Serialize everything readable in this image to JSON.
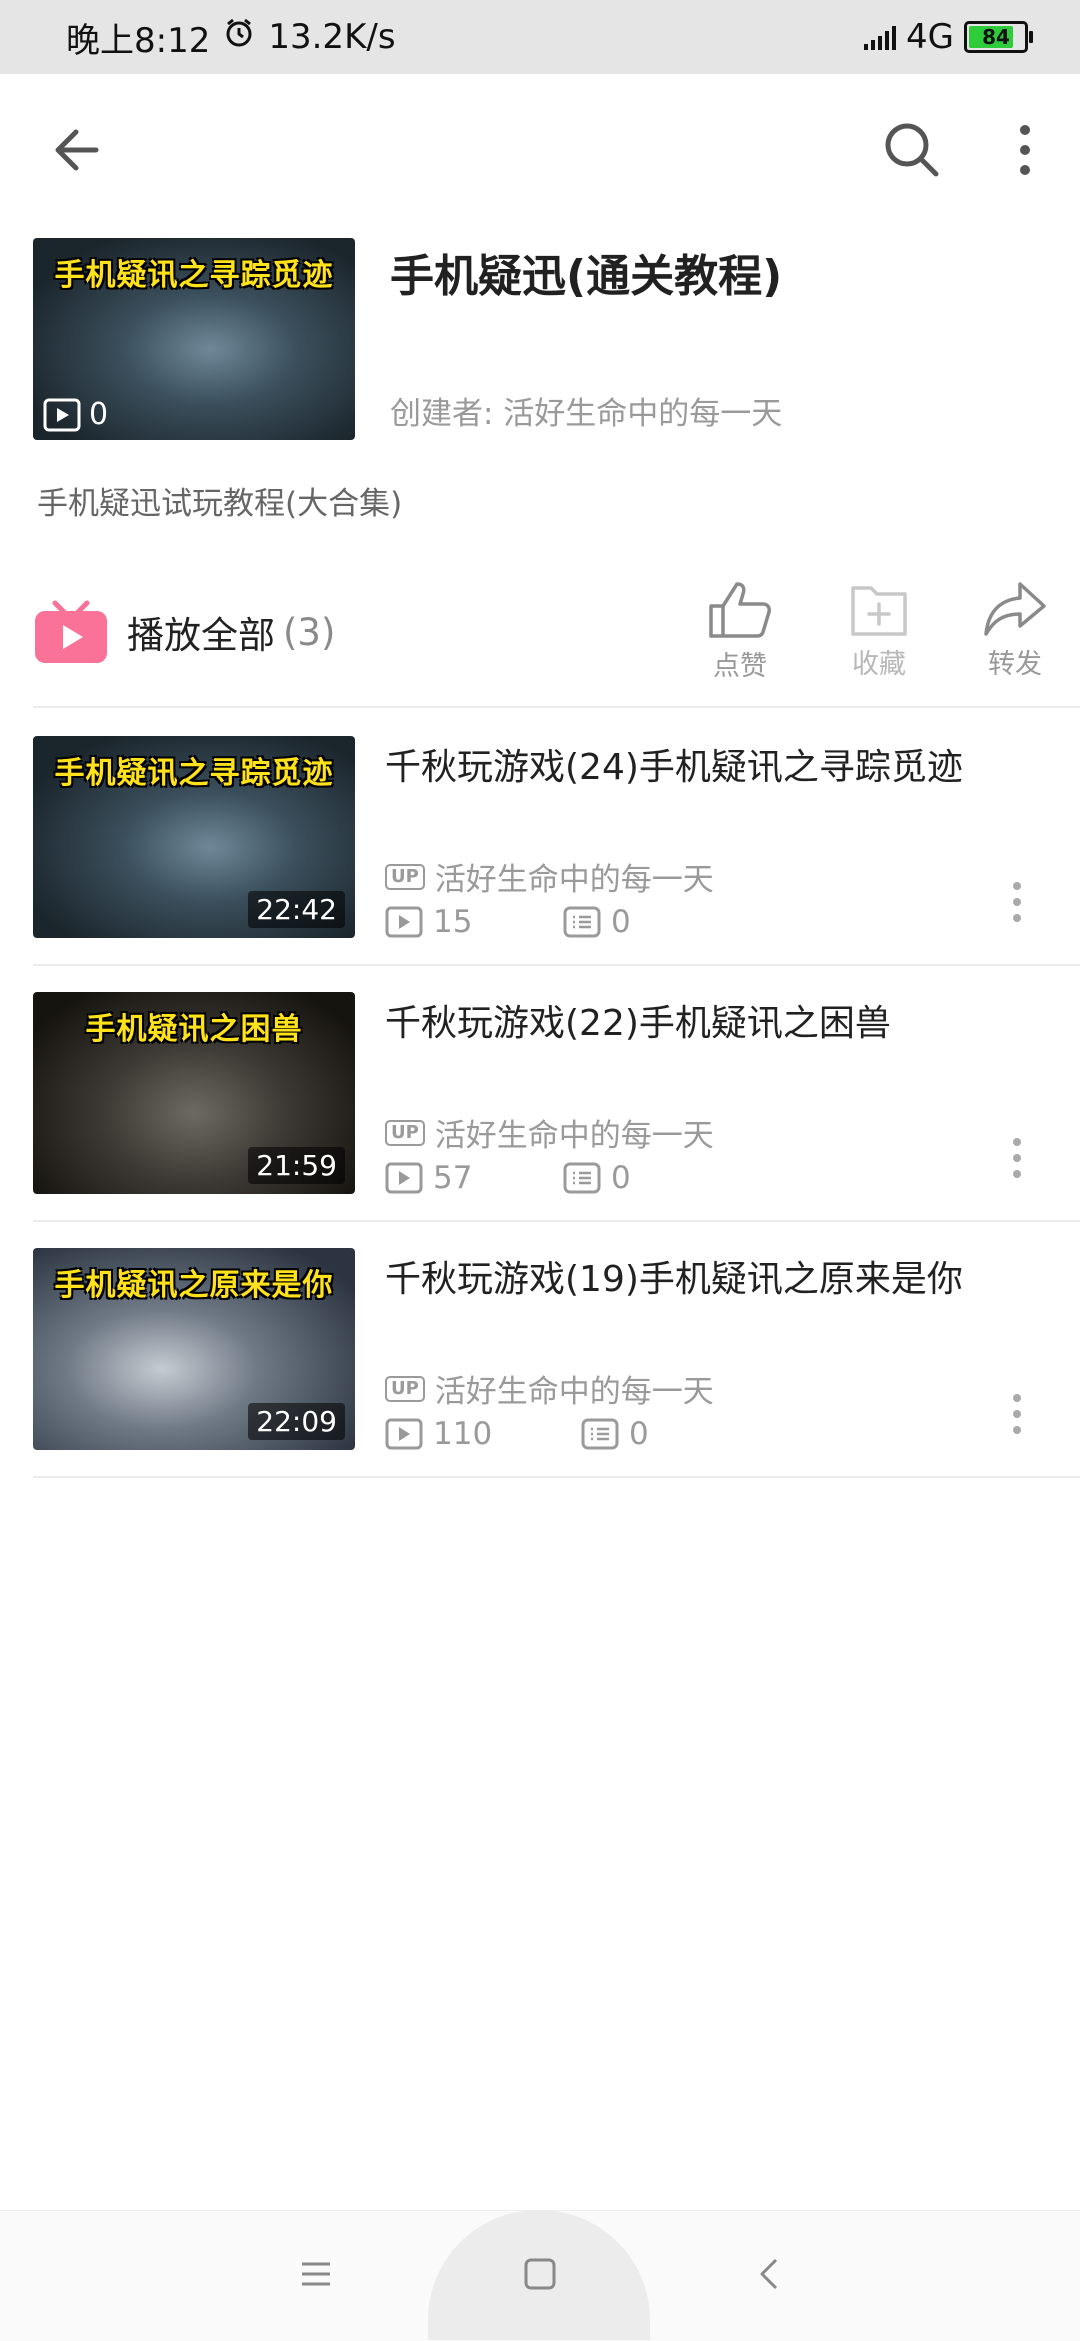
{
  "status_bar": {
    "time": "晚上8:12",
    "net_speed": "13.2K/s",
    "network": "4G",
    "battery": "84",
    "battery_level": 0.84
  },
  "app_bar": {
    "icons": [
      "back-arrow-icon",
      "search-icon",
      "more-vertical-icon"
    ]
  },
  "collection": {
    "thumb_title": "手机疑讯之寻踪觅迹",
    "video_count": "0",
    "title": "手机疑迅(通关教程)",
    "creator": "创建者: 活好生命中的每一天",
    "description": "手机疑迅试玩教程(大合集)"
  },
  "play_all": {
    "label": "播放全部",
    "count": "(3)",
    "accent": "#fb7299"
  },
  "actions": {
    "like": "点赞",
    "favorite": "收藏",
    "share": "转发"
  },
  "videos": [
    {
      "thumb_title": "手机疑讯之寻踪觅迹",
      "duration": "22:42",
      "title": "千秋玩游戏(24)手机疑讯之寻踪觅迹",
      "up_badge": "UP",
      "uploader": "活好生命中的每一天",
      "plays": "15",
      "comments": "0"
    },
    {
      "thumb_title": "手机疑讯之困兽",
      "duration": "21:59",
      "title": "千秋玩游戏(22)手机疑讯之困兽",
      "up_badge": "UP",
      "uploader": "活好生命中的每一天",
      "plays": "57",
      "comments": "0"
    },
    {
      "thumb_title": "手机疑讯之原来是你",
      "duration": "22:09",
      "title": "千秋玩游戏(19)手机疑讯之原来是你",
      "up_badge": "UP",
      "uploader": "活好生命中的每一天",
      "plays": "110",
      "comments": "0"
    }
  ]
}
